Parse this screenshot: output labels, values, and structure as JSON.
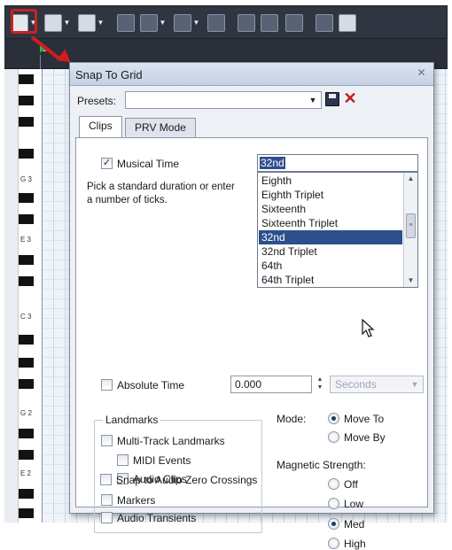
{
  "toolbar": {
    "icons": [
      "snap-to-grid-icon",
      "draw-tool-icon",
      "grid-options-icon",
      "ruler-icon",
      "mute-icon",
      "zoom-icon",
      "select-icon",
      "track-icon",
      "fit-icon",
      "marker-icon",
      "arrow-tool-icon",
      "pencil-icon"
    ]
  },
  "ruler": {
    "marker": "1"
  },
  "piano": {
    "note_labels": [
      "G 3",
      "E 3",
      "C 3",
      "G 2",
      "E 2"
    ]
  },
  "dialog": {
    "title": "Snap To Grid",
    "close_glyph": "✕",
    "presets_label": "Presets:",
    "presets_value": "",
    "tabs": [
      "Clips",
      "PRV Mode"
    ],
    "musical_time": {
      "label": "Musical Time",
      "checked": true,
      "value": "32nd",
      "help": "Pick a standard duration or enter a number of ticks.",
      "options": [
        "Eighth",
        "Eighth Triplet",
        "Sixteenth",
        "Sixteenth Triplet",
        "32nd",
        "32nd Triplet",
        "64th",
        "64th Triplet"
      ],
      "selected_option": "32nd"
    },
    "absolute_time": {
      "label": "Absolute Time",
      "checked": false,
      "value": "0.000",
      "units": "Seconds"
    },
    "landmarks": {
      "title": "Landmarks",
      "multi_track": {
        "label": "Multi-Track Landmarks",
        "checked": false
      },
      "midi_events": {
        "label": "MIDI Events",
        "checked": false
      },
      "audio_clips": {
        "label": "Audio Clips",
        "checked": false
      },
      "markers": {
        "label": "Markers",
        "checked": false
      },
      "audio_transients": {
        "label": "Audio Transients",
        "checked": false
      }
    },
    "zero_crossings": {
      "label": "Snap to Audio Zero Crossings",
      "checked": false
    },
    "mode": {
      "label": "Mode:",
      "options": [
        "Move To",
        "Move By"
      ],
      "selected": "Move To"
    },
    "magnetic": {
      "label": "Magnetic Strength:",
      "options": [
        "Off",
        "Low",
        "Med",
        "High"
      ],
      "selected": "Med"
    }
  },
  "colors": {
    "selection": "#2e4f8e",
    "annotation": "#d01d1d",
    "toolbar_bg": "#2f3541"
  }
}
